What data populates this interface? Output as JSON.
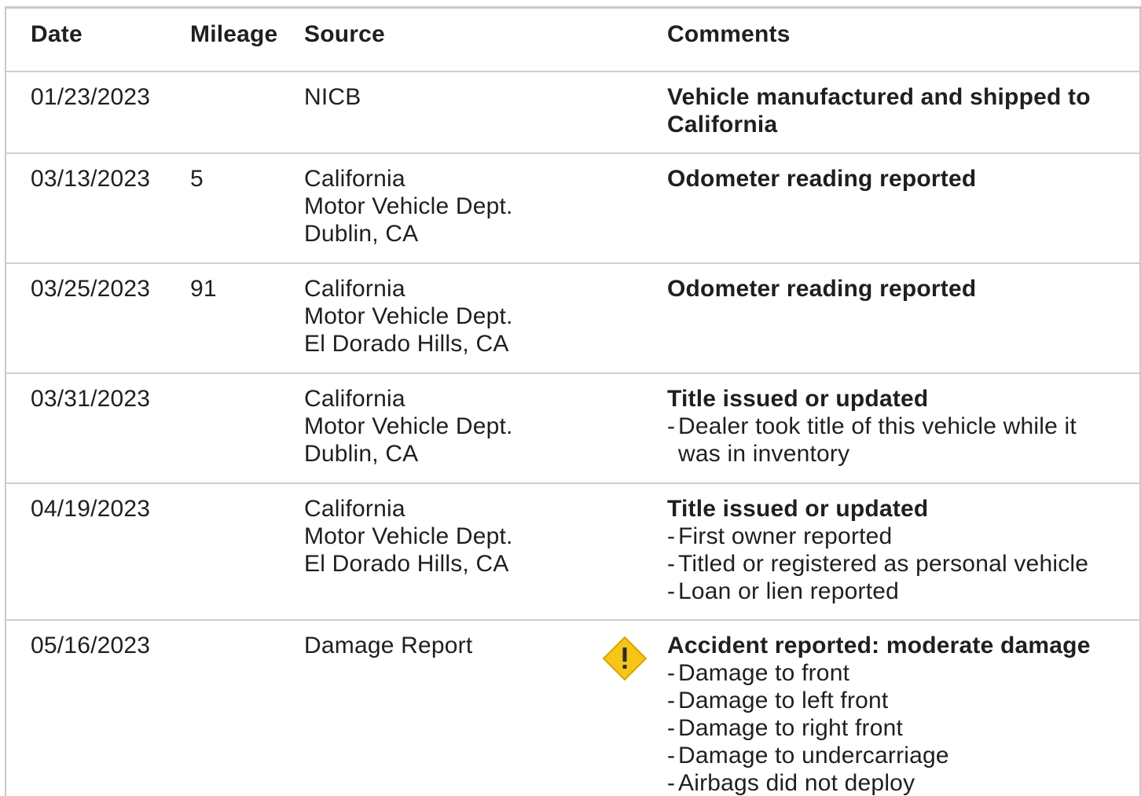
{
  "header": {
    "date": "Date",
    "mileage": "Mileage",
    "source": "Source",
    "comments": "Comments"
  },
  "rows": [
    {
      "date": "01/23/2023",
      "mileage": "",
      "source": [
        "NICB"
      ],
      "comment_title": [
        "Vehicle manufactured and shipped to",
        "California"
      ],
      "details": []
    },
    {
      "date": "03/13/2023",
      "mileage": "5",
      "source": [
        "California",
        "Motor Vehicle Dept.",
        "Dublin, CA"
      ],
      "comment_title": [
        "Odometer reading reported"
      ],
      "details": []
    },
    {
      "date": "03/25/2023",
      "mileage": "91",
      "source": [
        "California",
        "Motor Vehicle Dept.",
        "El Dorado Hills, CA"
      ],
      "comment_title": [
        "Odometer reading reported"
      ],
      "details": []
    },
    {
      "date": "03/31/2023",
      "mileage": "",
      "source": [
        "California",
        "Motor Vehicle Dept.",
        "Dublin, CA"
      ],
      "comment_title": [
        "Title issued or updated"
      ],
      "details": [
        [
          "Dealer took title of this vehicle while it",
          "was in inventory"
        ]
      ]
    },
    {
      "date": "04/19/2023",
      "mileage": "",
      "source": [
        "California",
        "Motor Vehicle Dept.",
        "El Dorado Hills, CA"
      ],
      "comment_title": [
        "Title issued or updated"
      ],
      "details": [
        [
          "First owner reported"
        ],
        [
          "Titled or registered as personal vehicle"
        ],
        [
          "Loan or lien reported"
        ]
      ]
    },
    {
      "date": "05/16/2023",
      "mileage": "",
      "source": [
        "Damage Report"
      ],
      "icon": "warning-icon",
      "comment_title": [
        "Accident reported: moderate damage"
      ],
      "details": [
        [
          "Damage to front"
        ],
        [
          "Damage to left front"
        ],
        [
          "Damage to right front"
        ],
        [
          "Damage to undercarriage"
        ],
        [
          "Airbags did not deploy"
        ]
      ]
    }
  ],
  "dash_glyph": "-",
  "colors": {
    "warning_fill": "#f5c518",
    "warning_stroke": "#d9a400",
    "warning_mark": "#2b2b2b",
    "border": "#cfcfcf"
  }
}
